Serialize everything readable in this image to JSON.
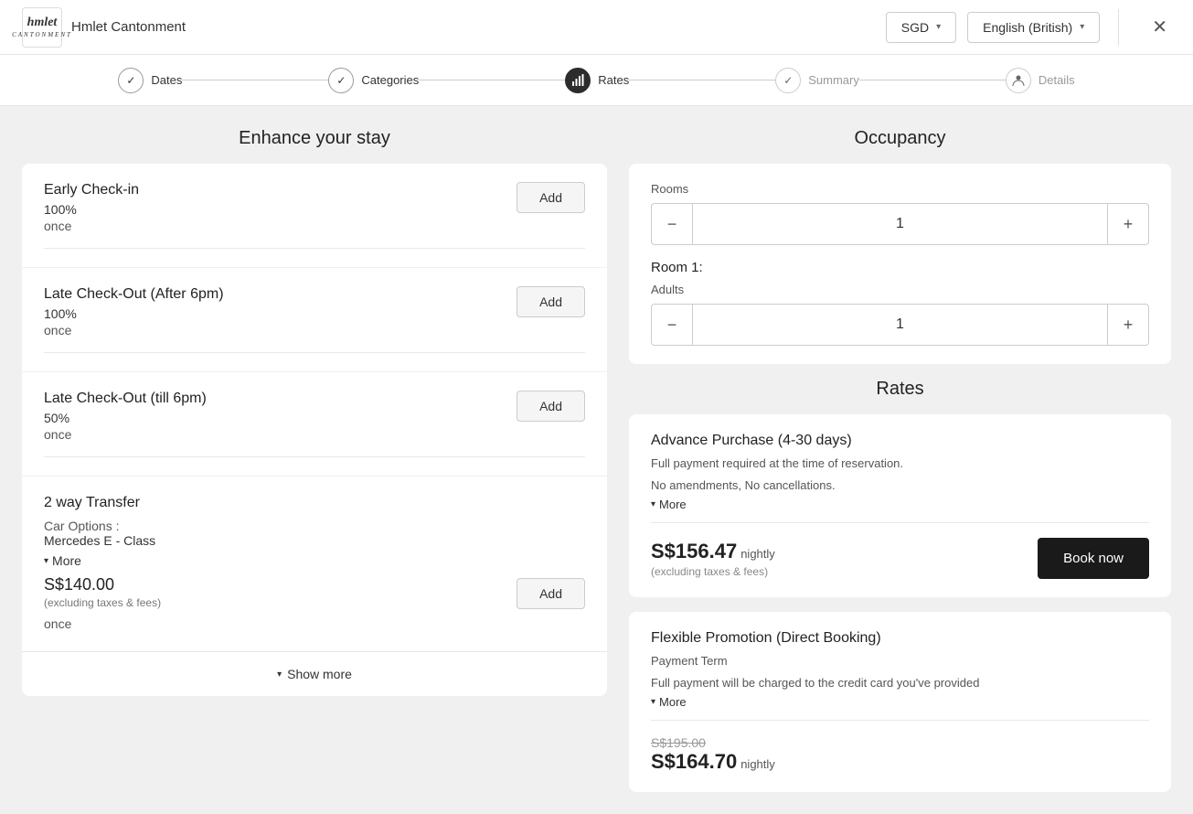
{
  "header": {
    "logo_top": "hmlet",
    "logo_sub": "CANTONMENT",
    "title": "Hmlet Cantonment",
    "currency": "SGD",
    "language": "English (British)"
  },
  "progress": {
    "steps": [
      {
        "id": "dates",
        "label": "Dates",
        "state": "completed",
        "icon": "✓"
      },
      {
        "id": "categories",
        "label": "Categories",
        "state": "completed",
        "icon": "✓"
      },
      {
        "id": "rates",
        "label": "Rates",
        "state": "active",
        "icon": "📊"
      },
      {
        "id": "summary",
        "label": "Summary",
        "state": "upcoming",
        "icon": "✓"
      },
      {
        "id": "details",
        "label": "Details",
        "state": "upcoming",
        "icon": "👤"
      }
    ]
  },
  "enhance": {
    "title": "Enhance your stay",
    "addons": [
      {
        "name": "Early Check-in",
        "price": "100%",
        "frequency": "once",
        "button": "Add"
      },
      {
        "name": "Late Check-Out (After 6pm)",
        "price": "100%",
        "frequency": "once",
        "button": "Add"
      },
      {
        "name": "Late Check-Out (till 6pm)",
        "price": "50%",
        "frequency": "once",
        "button": "Add"
      }
    ],
    "transfer": {
      "name": "2 way Transfer",
      "car_options_label": "Car Options :",
      "car_model": "Mercedes E - Class",
      "more_label": "More",
      "price": "S$140.00",
      "excl_taxes": "(excluding taxes & fees)",
      "frequency": "once",
      "button": "Add"
    },
    "show_more": "Show more"
  },
  "occupancy": {
    "title": "Occupancy",
    "rooms_label": "Rooms",
    "rooms_value": "1",
    "room1_label": "Room 1:",
    "adults_label": "Adults",
    "adults_value": "1"
  },
  "rates": {
    "title": "Rates",
    "rate1": {
      "name": "Advance Purchase (4-30 days)",
      "desc1": "Full payment required at the time of reservation.",
      "desc2": "No amendments, No cancellations.",
      "more_label": "More",
      "price": "S$156.47",
      "nightly": "nightly",
      "excl_taxes": "(excluding taxes & fees)",
      "book_button": "Book now"
    },
    "rate2": {
      "name": "Flexible Promotion (Direct Booking)",
      "desc1": "Payment Term",
      "desc2": "Full payment will be charged to the credit card you've provided",
      "more_label": "More",
      "original_price": "S$195.00",
      "price": "S$164.70",
      "nightly": "nightly"
    }
  }
}
